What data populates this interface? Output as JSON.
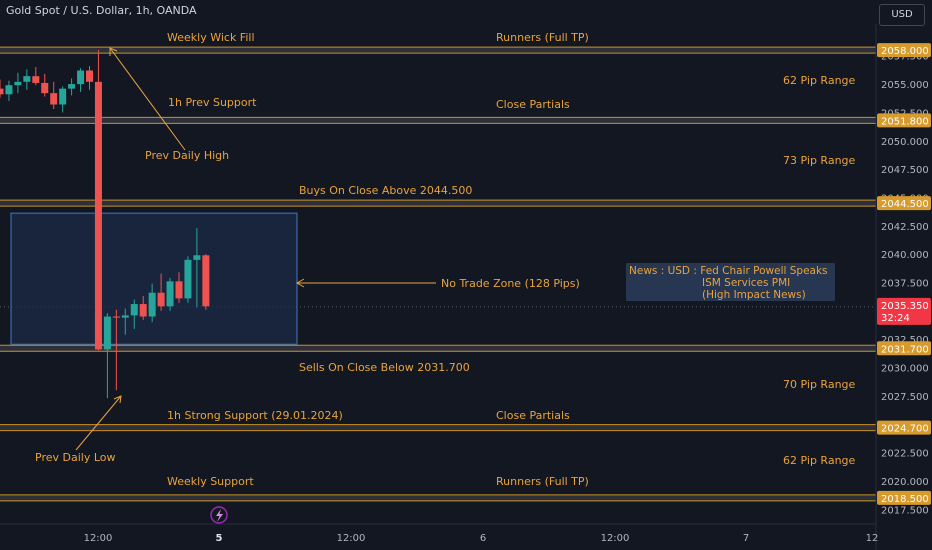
{
  "header": {
    "symbol_title": "Gold Spot / U.S. Dollar, 1h, OANDA"
  },
  "currency_button": {
    "label": "USD"
  },
  "colors": {
    "background": "#131722",
    "level_line": "#c89020",
    "level_band": "#434651",
    "annotation_text": "#e8a33d",
    "bull": "#26a69a",
    "bear": "#ef5350",
    "axis_text": "#b2b5be",
    "zone_fill": "#1c2b45",
    "zone_border": "#3f78c8",
    "news_box": "#2a3a57",
    "price_label_bg": "#d69a2d",
    "current_price_bg": "#f23645"
  },
  "price_axis": {
    "ticks": [
      "2057.500",
      "2055.000",
      "2052.500",
      "2050.000",
      "2047.500",
      "2045.000",
      "2042.500",
      "2040.000",
      "2037.500",
      "2035.000",
      "2032.500",
      "2030.000",
      "2027.500",
      "2025.000",
      "2022.500",
      "2020.000",
      "2017.500"
    ]
  },
  "time_axis": {
    "ticks": [
      "12:00",
      "5",
      "12:00",
      "6",
      "12:00",
      "7",
      "12"
    ]
  },
  "levels": [
    {
      "price": 2058.0,
      "label": "2058.000"
    },
    {
      "price": 2051.8,
      "label": "2051.800"
    },
    {
      "price": 2044.5,
      "label": "2044.500"
    },
    {
      "price": 2031.7,
      "label": "2031.700"
    },
    {
      "price": 2024.7,
      "label": "2024.700"
    },
    {
      "price": 2018.5,
      "label": "2018.500"
    }
  ],
  "current_price": {
    "price": "2035.350",
    "countdown": "32:24"
  },
  "annotations": {
    "weekly_wick_fill": "Weekly Wick Fill",
    "runners_top": "Runners (Full TP)",
    "pip_range_62_top": "62 Pip Range",
    "prev_support_1h": "1h Prev Support",
    "close_partials_top": "Close Partials",
    "prev_daily_high": "Prev Daily High",
    "pip_range_73": "73 Pip Range",
    "buys_above": "Buys On Close Above 2044.500",
    "no_trade_zone": "No Trade Zone (128 Pips)",
    "news_line1": "News : USD : Fed Chair Powell Speaks",
    "news_line2": "ISM Services PMI",
    "news_line3": "(High Impact News)",
    "sells_below": "Sells On Close Below 2031.700",
    "pip_range_70": "70 Pip Range",
    "strong_support_1h": "1h Strong Support (29.01.2024)",
    "close_partials_bottom": "Close Partials",
    "prev_daily_low": "Prev Daily Low",
    "pip_range_62_bottom": "62 Pip Range",
    "weekly_support": "Weekly Support",
    "runners_bottom": "Runners (Full TP)"
  },
  "chart_data": {
    "type": "candlestick",
    "title": "Gold Spot / U.S. Dollar, 1h, OANDA",
    "ylim": [
      2016.2,
      2060.3
    ],
    "x_start": 0,
    "candles": [
      {
        "o": 2054.6,
        "h": 2055.4,
        "l": 2053.8,
        "c": 2054.1
      },
      {
        "o": 2054.1,
        "h": 2055.3,
        "l": 2053.5,
        "c": 2054.9
      },
      {
        "o": 2054.9,
        "h": 2056.0,
        "l": 2054.2,
        "c": 2055.2
      },
      {
        "o": 2055.2,
        "h": 2056.3,
        "l": 2054.5,
        "c": 2055.7
      },
      {
        "o": 2055.7,
        "h": 2056.5,
        "l": 2054.9,
        "c": 2055.1
      },
      {
        "o": 2055.1,
        "h": 2055.9,
        "l": 2053.9,
        "c": 2054.2
      },
      {
        "o": 2054.2,
        "h": 2055.2,
        "l": 2052.8,
        "c": 2053.2
      },
      {
        "o": 2053.2,
        "h": 2054.8,
        "l": 2052.5,
        "c": 2054.6
      },
      {
        "o": 2054.6,
        "h": 2055.5,
        "l": 2054.0,
        "c": 2055.0
      },
      {
        "o": 2055.0,
        "h": 2056.4,
        "l": 2054.3,
        "c": 2056.2
      },
      {
        "o": 2056.2,
        "h": 2056.6,
        "l": 2054.5,
        "c": 2055.2
      },
      {
        "o": 2055.2,
        "h": 2058.0,
        "l": 2031.5,
        "c": 2031.6
      },
      {
        "o": 2031.6,
        "h": 2034.8,
        "l": 2027.3,
        "c": 2034.5
      },
      {
        "o": 2034.5,
        "h": 2035.1,
        "l": 2028.0,
        "c": 2034.4
      },
      {
        "o": 2034.4,
        "h": 2035.2,
        "l": 2032.9,
        "c": 2034.6
      },
      {
        "o": 2034.6,
        "h": 2036.0,
        "l": 2033.4,
        "c": 2035.6
      },
      {
        "o": 2035.6,
        "h": 2036.3,
        "l": 2034.2,
        "c": 2034.5
      },
      {
        "o": 2034.5,
        "h": 2037.4,
        "l": 2034.0,
        "c": 2036.6
      },
      {
        "o": 2036.6,
        "h": 2038.3,
        "l": 2035.0,
        "c": 2035.4
      },
      {
        "o": 2035.4,
        "h": 2037.9,
        "l": 2035.0,
        "c": 2037.6
      },
      {
        "o": 2037.6,
        "h": 2038.4,
        "l": 2035.7,
        "c": 2036.1
      },
      {
        "o": 2036.1,
        "h": 2039.8,
        "l": 2035.7,
        "c": 2039.5
      },
      {
        "o": 2039.5,
        "h": 2042.3,
        "l": 2035.3,
        "c": 2039.9
      },
      {
        "o": 2039.9,
        "h": 2040.0,
        "l": 2035.1,
        "c": 2035.4
      }
    ]
  }
}
